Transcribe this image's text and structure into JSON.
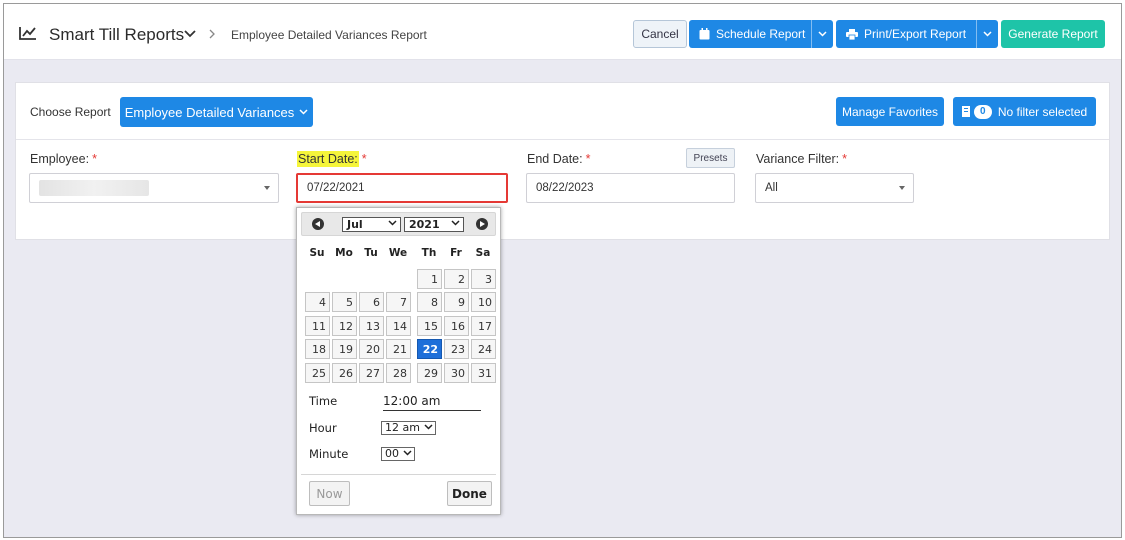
{
  "header": {
    "app_title": "Smart Till Reports",
    "breadcrumb": "Employee Detailed Variances Report",
    "cancel_label": "Cancel",
    "schedule_label": "Schedule Report",
    "print_label": "Print/Export Report",
    "generate_label": "Generate Report",
    "icons": [
      "line-chart-icon",
      "chevron-down-icon",
      "chevron-right-icon",
      "calendar-icon",
      "printer-icon"
    ]
  },
  "report": {
    "choose_label": "Choose Report",
    "selected_report": "Employee Detailed Variances",
    "manage_favorites": "Manage Favorites",
    "filter_count": "0",
    "filter_label": "No filter selected"
  },
  "fields": {
    "employee_label": "Employee:",
    "start_label": "Start Date:",
    "end_label": "End Date:",
    "variance_label": "Variance Filter:",
    "required_mark": "*",
    "start_value": "07/22/2021",
    "end_value": "08/22/2023",
    "variance_value": "All",
    "presets_label": "Presets"
  },
  "datepicker": {
    "month": "Jul",
    "year": "2021",
    "weekdays": [
      "Su",
      "Mo",
      "Tu",
      "We",
      "Th",
      "Fr",
      "Sa"
    ],
    "first_weekday_index": 4,
    "days_in_month": 31,
    "selected_day": 22,
    "time_label": "Time",
    "time_value": "12:00 am",
    "hour_label": "Hour",
    "hour_value": "12 am",
    "minute_label": "Minute",
    "minute_value": "00",
    "now_label": "Now",
    "done_label": "Done"
  },
  "colors": {
    "primary": "#1e88e5",
    "generate": "#1ec4a8",
    "required": "#e53935",
    "highlight": "#f5f53a",
    "selected_day": "#1e6fd9"
  }
}
